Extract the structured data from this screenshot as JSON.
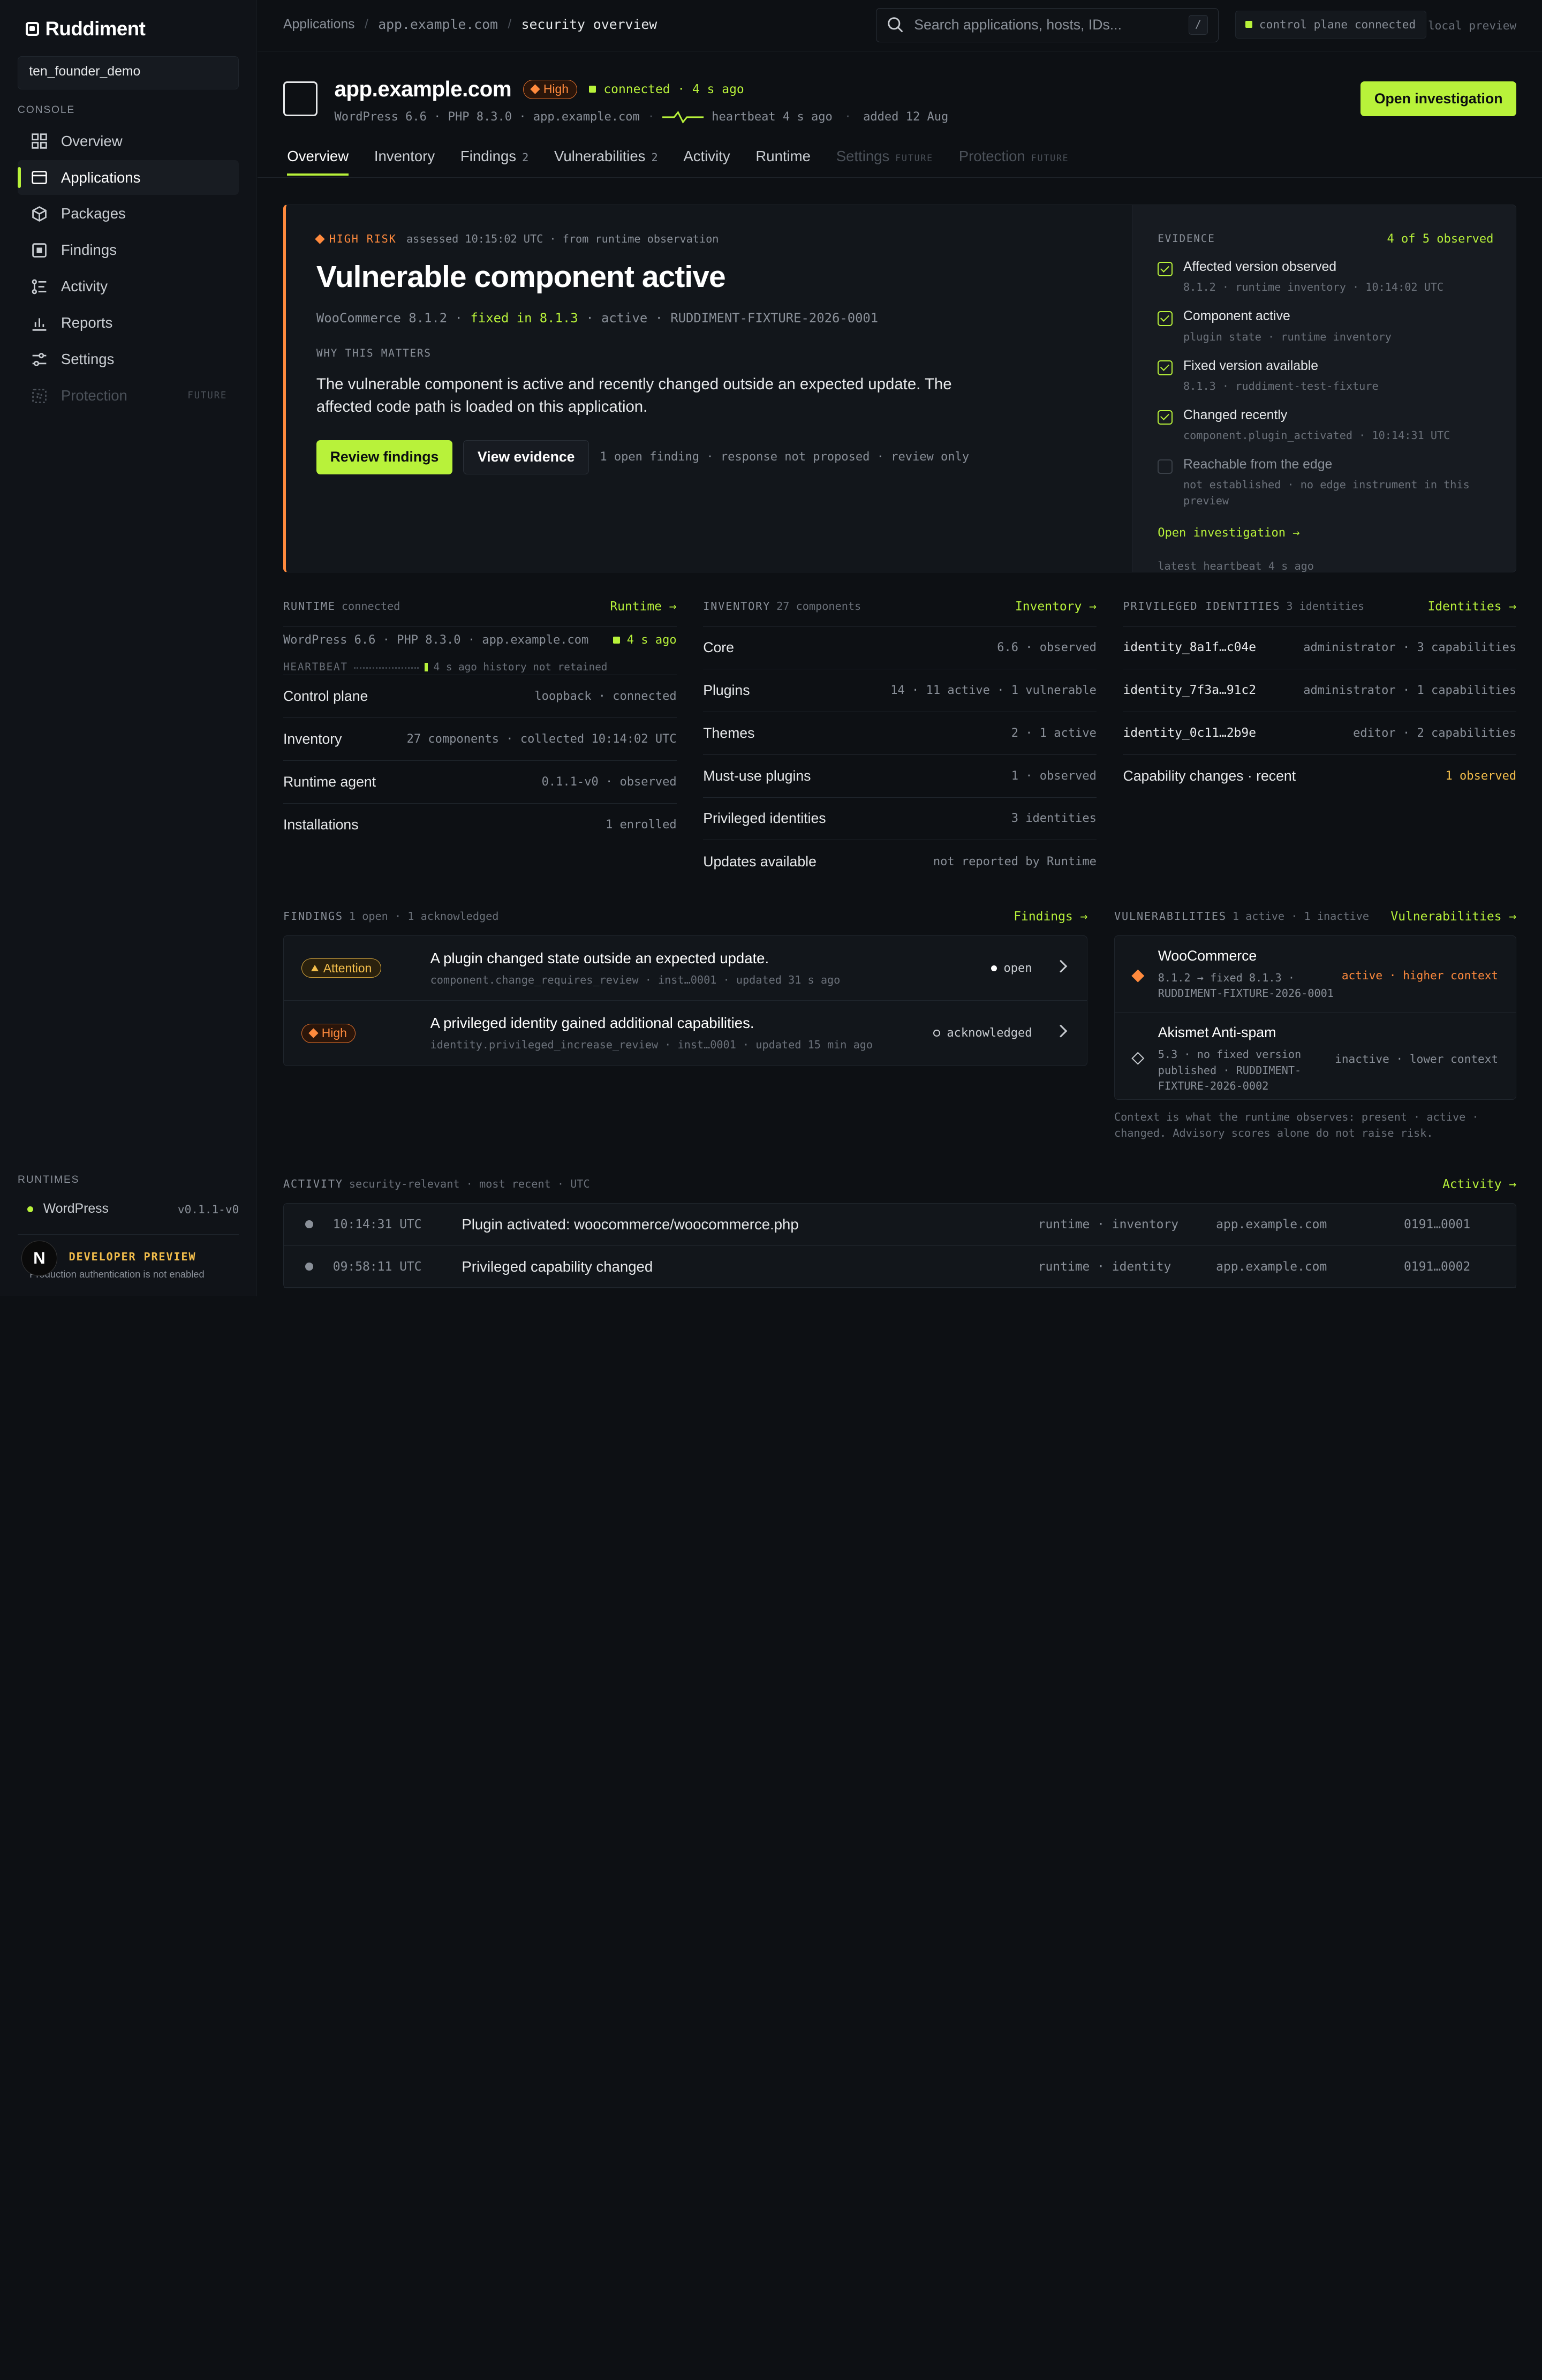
{
  "sidebar": {
    "brand": "Ruddiment",
    "workspace": "ten_founder_demo",
    "console_label": "CONSOLE",
    "items": [
      {
        "label": "Overview"
      },
      {
        "label": "Applications"
      },
      {
        "label": "Packages"
      },
      {
        "label": "Findings"
      },
      {
        "label": "Activity"
      },
      {
        "label": "Reports"
      },
      {
        "label": "Settings"
      },
      {
        "label": "Protection",
        "badge": "FUTURE"
      }
    ],
    "runtimes_label": "RUNTIMES",
    "runtime": {
      "name": "WordPress",
      "version": "v0.1.1-v0"
    },
    "dev_preview": {
      "avatar": "N",
      "title": "DEVELOPER PREVIEW",
      "note": "Production authentication is not enabled"
    }
  },
  "topbar": {
    "breadcrumb": [
      "Applications",
      "app.example.com",
      "security overview"
    ],
    "search_placeholder": "Search applications, hosts, IDs...",
    "search_kbd": "/",
    "control_plane": "control plane connected",
    "local_preview": "local preview"
  },
  "app": {
    "name": "app.example.com",
    "risk_badge": "High",
    "connected": "connected · 4 s ago",
    "sub": "WordPress 6.6 · PHP 8.3.0 · app.example.com",
    "sub_sep": "·",
    "heartbeat": "heartbeat 4 s ago",
    "added": "added 12 Aug",
    "open_investigation": "Open investigation"
  },
  "tabs": [
    {
      "label": "Overview",
      "count": ""
    },
    {
      "label": "Inventory",
      "count": ""
    },
    {
      "label": "Findings",
      "count": "2"
    },
    {
      "label": "Vulnerabilities",
      "count": "2"
    },
    {
      "label": "Activity",
      "count": ""
    },
    {
      "label": "Runtime",
      "count": ""
    },
    {
      "label": "Settings",
      "count": "FUTURE"
    },
    {
      "label": "Protection",
      "count": "FUTURE"
    }
  ],
  "risk": {
    "tag": "HIGH RISK",
    "assessed": "assessed 10:15:02 UTC · from runtime observation",
    "title": "Vulnerable component active",
    "meta_component": "WooCommerce 8.1.2 ·",
    "meta_fixed": "fixed in 8.1.3",
    "meta_rest": "· active · RUDDIMENT-FIXTURE-2026-0001",
    "why_label": "WHY THIS MATTERS",
    "why_text": "The vulnerable component is active and recently changed outside an expected update. The affected code path is loaded on this application.",
    "review_btn": "Review findings",
    "evidence_btn": "View evidence",
    "action_meta": "1 open finding · response not proposed · review only"
  },
  "evidence": {
    "label": "EVIDENCE",
    "observed": "4 of 5 observed",
    "items": [
      {
        "title": "Affected version observed",
        "sub": "8.1.2 · runtime inventory · 10:14:02 UTC"
      },
      {
        "title": "Component active",
        "sub": "plugin state · runtime inventory"
      },
      {
        "title": "Fixed version available",
        "sub": "8.1.3 · ruddiment-test-fixture"
      },
      {
        "title": "Changed recently",
        "sub": "component.plugin_activated · 10:14:31 UTC"
      },
      {
        "title": "Reachable from the edge",
        "sub": "not established · no edge instrument in this preview"
      }
    ],
    "link": "Open investigation →",
    "heartbeat": "latest heartbeat 4 s ago"
  },
  "runtime": {
    "label": "RUNTIME",
    "status": "connected",
    "link": "Runtime →",
    "summary": "WordPress 6.6 · PHP 8.3.0 · app.example.com",
    "age": "4 s ago",
    "hb_label": "HEARTBEAT",
    "hb_meta": "4 s ago  history not retained",
    "rows": [
      {
        "k": "Control plane",
        "v": "loopback · connected"
      },
      {
        "k": "Inventory",
        "v": "27 components · collected 10:14:02 UTC"
      },
      {
        "k": "Runtime agent",
        "v": "0.1.1-v0 · observed"
      },
      {
        "k": "Installations",
        "v": "1 enrolled"
      }
    ]
  },
  "inventory": {
    "label": "INVENTORY",
    "status": "27 components",
    "link": "Inventory →",
    "rows": [
      {
        "k": "Core",
        "v": "6.6 · observed"
      },
      {
        "k": "Plugins",
        "v": "14 · 11 active · 1 vulnerable"
      },
      {
        "k": "Themes",
        "v": "2 · 1 active"
      },
      {
        "k": "Must-use plugins",
        "v": "1 · observed"
      },
      {
        "k": "Privileged identities",
        "v": "3 identities"
      },
      {
        "k": "Updates available",
        "v": "not reported by Runtime"
      }
    ]
  },
  "identities": {
    "label": "PRIVILEGED IDENTITIES",
    "status": "3 identities",
    "link": "Identities →",
    "rows": [
      {
        "k": "identity_8a1f…c04e",
        "v": "administrator · 3 capabilities"
      },
      {
        "k": "identity_7f3a…91c2",
        "v": "administrator · 1 capabilities"
      },
      {
        "k": "identity_0c11…2b9e",
        "v": "editor · 2 capabilities"
      },
      {
        "k": "Capability changes · recent",
        "v": "1 observed"
      }
    ]
  },
  "findings": {
    "label": "FINDINGS",
    "status": "1 open · 1 acknowledged",
    "link": "Findings →",
    "rows": [
      {
        "badge": "Attention",
        "title": "A plugin changed state outside an expected update.",
        "sub": "component.change_requires_review · inst…0001 · updated 31 s ago",
        "state": "open"
      },
      {
        "badge": "High",
        "title": "A privileged identity gained additional capabilities.",
        "sub": "identity.privileged_increase_review · inst…0001 · updated 15 min ago",
        "state": "acknowledged"
      }
    ]
  },
  "vulns": {
    "label": "VULNERABILITIES",
    "status": "1 active · 1 inactive",
    "link": "Vulnerabilities →",
    "rows": [
      {
        "name": "WooCommerce",
        "sub": "8.1.2 → fixed 8.1.3 · RUDDIMENT-FIXTURE-2026-0001",
        "state": "active · higher context"
      },
      {
        "name": "Akismet Anti-spam",
        "sub": "5.3 · no fixed version published · RUDDIMENT-FIXTURE-2026-0002",
        "state": "inactive · lower context"
      }
    ],
    "context": "Context is what the runtime observes: present · active · changed. Advisory scores alone do not raise risk."
  },
  "activity": {
    "label": "ACTIVITY",
    "status": "security-relevant · most recent · UTC",
    "link": "Activity →",
    "rows": [
      {
        "time": "10:14:31 UTC",
        "event": "Plugin activated: woocommerce/woocommerce.php",
        "source": "runtime · inventory",
        "host": "app.example.com",
        "id": "0191…0001"
      },
      {
        "time": "09:58:11 UTC",
        "event": "Privileged capability changed",
        "source": "runtime · identity",
        "host": "app.example.com",
        "id": "0191…0002"
      }
    ]
  }
}
